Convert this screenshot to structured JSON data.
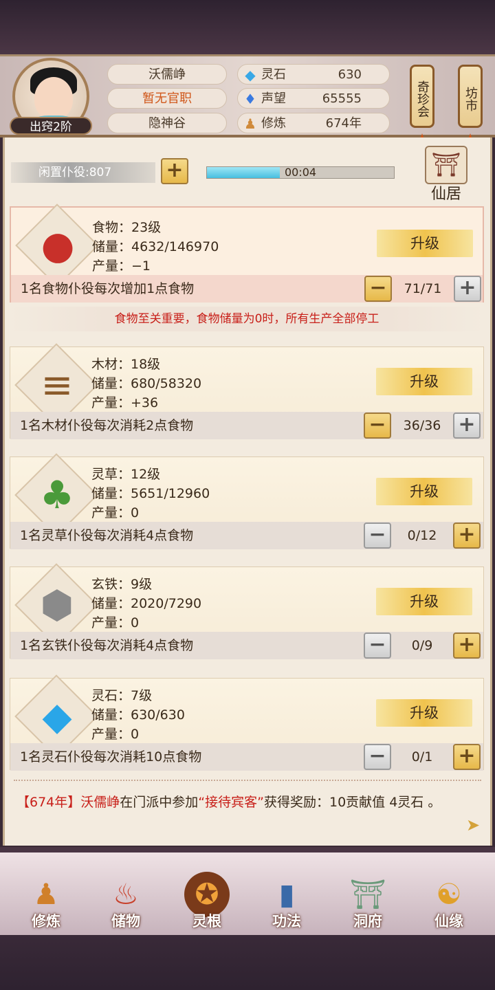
{
  "header": {
    "name": "沃儒峥",
    "official_post": "暂无官职",
    "sect": "隐神谷",
    "rank": "出窍2阶",
    "resources": [
      {
        "icon": "spirit-stone-icon",
        "label": "灵石",
        "value": "630"
      },
      {
        "icon": "prestige-icon",
        "label": "声望",
        "value": "65555"
      },
      {
        "icon": "cultivation-icon",
        "label": "修炼",
        "value": "674年"
      }
    ],
    "lanterns": [
      "奇珍会",
      "坊市"
    ]
  },
  "idle": {
    "label": "闲置仆役:807",
    "timer": "00:04",
    "progress": 0.39
  },
  "residence": {
    "label": "仙居"
  },
  "warning": "食物至关重要，食物储量为0时，所有生产全部停工",
  "cards": [
    {
      "icon": "meat-icon",
      "name": "食物：23级",
      "storage": "储量：4632/146970",
      "output": "产量：−1",
      "upgrade": "升级",
      "worker_text": "1名食物仆役每次增加1点食物",
      "workers": "71/71"
    },
    {
      "icon": "wood-icon",
      "name": "木材：18级",
      "storage": "储量：680/58320",
      "output": "产量：+36",
      "upgrade": "升级",
      "worker_text": "1名木材仆役每次消耗2点食物",
      "workers": "36/36"
    },
    {
      "icon": "herb-icon",
      "name": "灵草：12级",
      "storage": "储量：5651/12960",
      "output": "产量：0",
      "upgrade": "升级",
      "worker_text": "1名灵草仆役每次消耗4点食物",
      "workers": "0/12"
    },
    {
      "icon": "iron-icon",
      "name": "玄铁：9级",
      "storage": "储量：2020/7290",
      "output": "产量：0",
      "upgrade": "升级",
      "worker_text": "1名玄铁仆役每次消耗4点食物",
      "workers": "0/9"
    },
    {
      "icon": "crystal-icon",
      "name": "灵石：7级",
      "storage": "储量：630/630",
      "output": "产量：0",
      "upgrade": "升级",
      "worker_text": "1名灵石仆役每次消耗10点食物",
      "workers": "0/1"
    }
  ],
  "log": {
    "year": "【674年】",
    "name": "沃儒峥",
    "pre": "在门派中参加",
    "event": "“接待宾客”",
    "post": "获得奖励：10贡献值 4灵石 。"
  },
  "nav": [
    {
      "icon": "cultivate-icon",
      "label": "修炼"
    },
    {
      "icon": "storage-bag-icon",
      "label": "储物"
    },
    {
      "icon": "spirit-root-icon",
      "label": "灵根"
    },
    {
      "icon": "technique-book-icon",
      "label": "功法"
    },
    {
      "icon": "cave-mansion-icon",
      "label": "洞府"
    },
    {
      "icon": "fate-icon",
      "label": "仙缘"
    }
  ],
  "colors": {
    "accent": "#f0c34e",
    "warning": "#c8201a",
    "highlight": "#d0571a"
  }
}
